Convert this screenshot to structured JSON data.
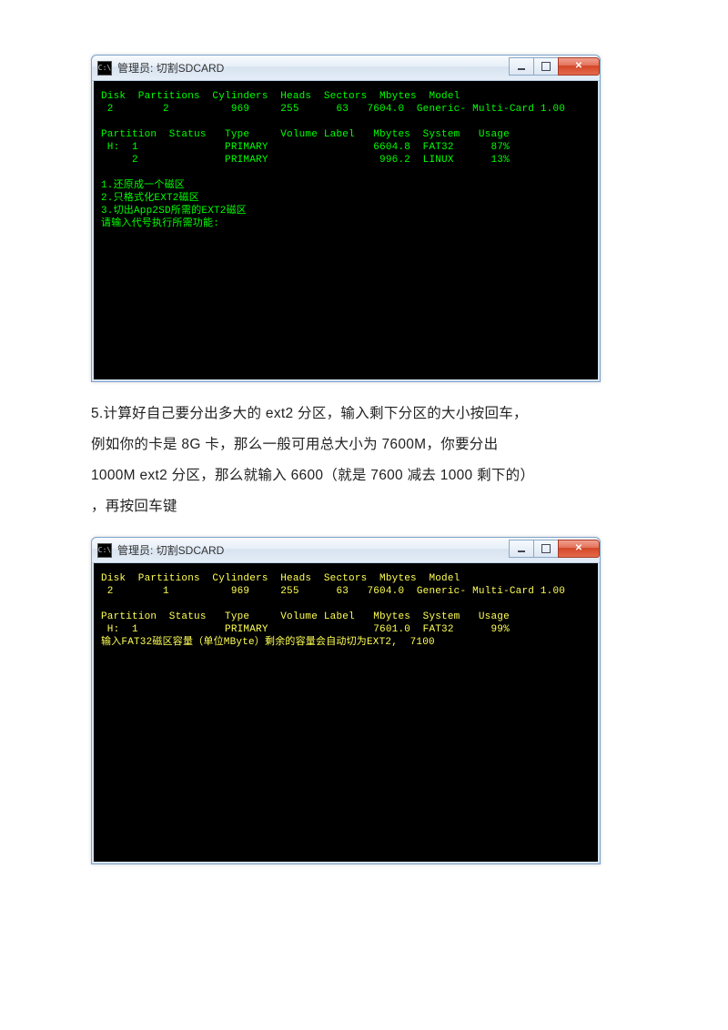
{
  "window1": {
    "title": "管理员: 切割SDCARD",
    "header_line": "Disk  Partitions  Cylinders  Heads  Sectors  Mbytes  Model",
    "disk_line": " 2        2          969     255      63   7604.0  Generic- Multi-Card 1.00",
    "part_header": "Partition  Status   Type     Volume Label   Mbytes  System   Usage",
    "part1": " H:  1              PRIMARY                 6604.8  FAT32      87%",
    "part2": "     2              PRIMARY                  996.2  LINUX      13%",
    "menu1": "1.还原成一个磁区",
    "menu2": "2.只格式化EXT2磁区",
    "menu3": "3.切出App2SD所需的EXT2磁区",
    "prompt": "请输入代号执行所需功能:"
  },
  "paragraph": {
    "line1": "5.计算好自己要分出多大的 ext2 分区，输入剩下分区的大小按回车，",
    "line2": "例如你的卡是 8G 卡，那么一般可用总大小为 7600M，你要分出",
    "line3": "1000M ext2 分区，那么就输入 6600（就是 7600 减去 1000 剩下的）",
    "line4": "，再按回车键"
  },
  "window2": {
    "title": "管理员: 切割SDCARD",
    "header_line": "Disk  Partitions  Cylinders  Heads  Sectors  Mbytes  Model",
    "disk_line": " 2        1          969     255      63   7604.0  Generic- Multi-Card 1.00",
    "part_header": "Partition  Status   Type     Volume Label   Mbytes  System   Usage",
    "part1": " H:  1              PRIMARY                 7601.0  FAT32      99%",
    "prompt": "输入FAT32磁区容量（单位MByte）剩余的容量会自动切为EXT2,  7100"
  }
}
